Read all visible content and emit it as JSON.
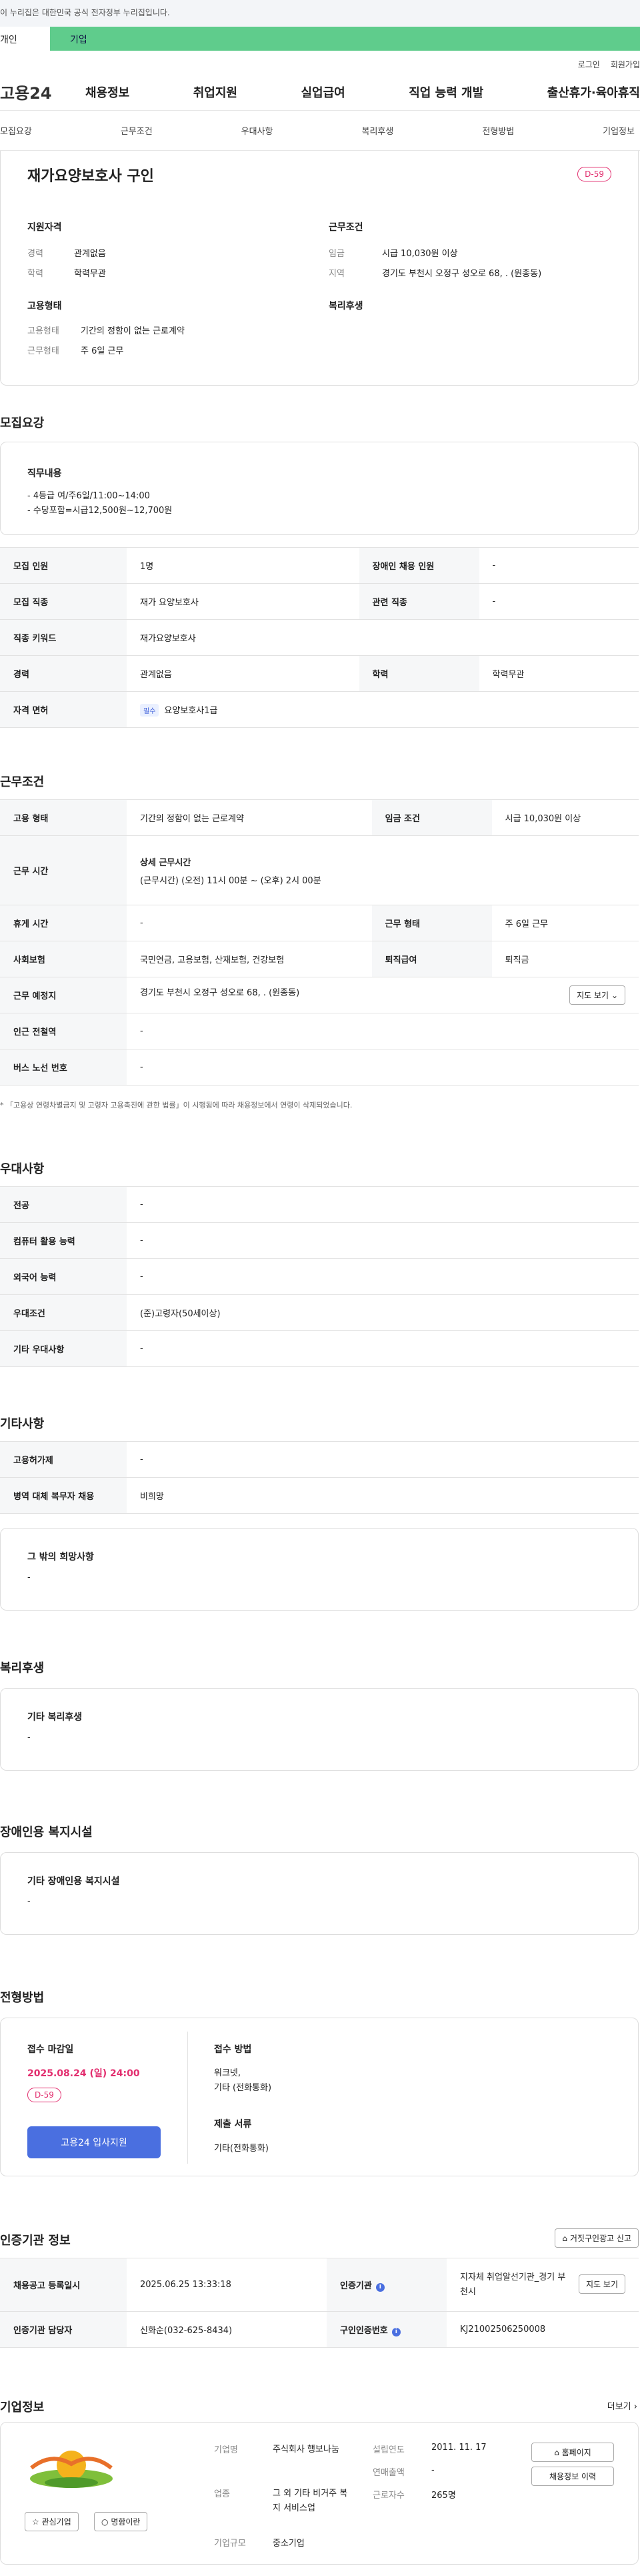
{
  "top_notice": "이 누리집은 대한민국 공식 전자정부 누리집입니다.",
  "user_tabs": [
    "개인",
    "기업"
  ],
  "util": [
    "로그인",
    "회원가입"
  ],
  "logo": "고용24",
  "gnb": [
    "채용정보",
    "취업지원",
    "실업급여",
    "직업 능력 개발",
    "출산휴가·육아휴직"
  ],
  "subnav": [
    "모집요강",
    "근무조건",
    "우대사항",
    "복리후생",
    "전형방법",
    "기업정보"
  ],
  "job": {
    "title": "재가요양보호사 구인",
    "dday": "D-59",
    "qual_head": "지원자격",
    "cond_head": "근무조건",
    "emp_head": "고용형태",
    "welfare_head": "복리후생",
    "qual": [
      [
        "경력",
        "관계없음"
      ],
      [
        "학력",
        "학력무관"
      ]
    ],
    "cond": [
      [
        "임금",
        "시급 10,030원 이상"
      ],
      [
        "지역",
        "경기도 부천시 오정구 성오로 68, . (원종동)"
      ]
    ],
    "emp": [
      [
        "고용형태",
        "기간의 정함이 없는 근로계약"
      ],
      [
        "근무형태",
        "주 6일 근무"
      ]
    ]
  },
  "recruit": {
    "head": "모집요강",
    "duty_head": "직무내용",
    "duty_lines": [
      "- 4등급 여/주6일/11:00~14:00",
      "- 수당포함=시급12,500원~12,700원"
    ],
    "rows": [
      [
        "모집 인원",
        "1명",
        "장애인 채용 인원",
        "-"
      ],
      [
        "모집 직종",
        "재가 요양보호사",
        "관련 직종",
        "-"
      ],
      [
        "직종 키워드",
        "재가요양보호사"
      ],
      [
        "경력",
        "관계없음",
        "학력",
        "학력무관"
      ]
    ],
    "license_label": "자격 면허",
    "license_tag": "필수",
    "license": "요양보호사1급"
  },
  "work": {
    "head": "근무조건",
    "emp_type_l": "고용 형태",
    "emp_type": "기간의 정함이 없는 근로계약",
    "wage_l": "임금 조건",
    "wage": "시급 10,030원 이상",
    "hours_l": "근무 시간",
    "hours_h": "상세 근무시간",
    "hours": "(근무시간) (오전) 11시 00분 ~ (오후) 2시 00분",
    "rest_l": "휴게 시간",
    "rest": "-",
    "shape_l": "근무 형태",
    "shape": "주 6일 근무",
    "ins_l": "사회보험",
    "ins": "국민연금, 고용보험, 산재보험, 건강보험",
    "sev_l": "퇴직급여",
    "sev": "퇴직금",
    "place_l": "근무 예정지",
    "place": "경기도 부천시 오정구 성오로 68, . (원종동)",
    "map_btn": "지도 보기",
    "subway_l": "인근 전철역",
    "subway": "-",
    "bus_l": "버스 노선 번호",
    "bus": "-",
    "note": "* 「고용상 연령차별금지 및 고령자 고용촉진에 관한 법률」이 시행됨에 따라 채용정보에서 연령이 삭제되었습니다."
  },
  "pref": {
    "head": "우대사항",
    "rows": [
      [
        "전공",
        "-"
      ],
      [
        "컴퓨터 활용 능력",
        "-"
      ],
      [
        "외국어 능력",
        "-"
      ],
      [
        "우대조건",
        "(준)고령자(50세이상)"
      ],
      [
        "기타 우대사항",
        "-"
      ]
    ]
  },
  "etc": {
    "head": "기타사항",
    "rows": [
      [
        "고용허가제",
        "-"
      ],
      [
        "병역 대체 복무자 채용",
        "비희망"
      ]
    ],
    "hope_head": "그 밖의 희망사항",
    "hope": "-"
  },
  "welfare": {
    "head": "복리후생",
    "sub": "기타 복리후생",
    "val": "-"
  },
  "disab": {
    "head": "장애인용 복지시설",
    "sub": "기타 장애인용 복지시설",
    "val": "-"
  },
  "select": {
    "head": "전형방법",
    "deadline_h": "접수 마감일",
    "deadline": "2025.08.24 (일) 24:00",
    "dday": "D-59",
    "apply": "고용24 입사지원",
    "method_h": "접수 방법",
    "methods": [
      "워크넷,",
      "기타 (전화통화)"
    ],
    "docs_h": "제출 서류",
    "docs": "기타(전화통화)"
  },
  "cert": {
    "head": "인증기관 정보",
    "report": "거짓구인광고 신고",
    "reg_l": "채용공고 등록일시",
    "reg": "2025.06.25 13:33:18",
    "org_l": "인증기관",
    "org": "지자체 취업알선기관_경기 부천시",
    "map": "지도 보기",
    "mgr_l": "인증기관 담당자",
    "mgr": "신화순(032-625-8434)",
    "num_l": "구인인증번호",
    "num": "KJ21002506250008"
  },
  "company": {
    "head": "기업정보",
    "more": "더보기",
    "fav": "관심기업",
    "card": "명함이란",
    "name_l": "기업명",
    "name": "주식회사 행보나눔",
    "ind_l": "업종",
    "ind": "그 외 기타 비거주 복지 서비스업",
    "size_l": "기업규모",
    "size": "중소기업",
    "est_l": "설립연도",
    "est": "2011. 11. 17",
    "sales_l": "연매출액",
    "sales": "-",
    "emp_l": "근로자수",
    "emp": "265명",
    "home": "홈페이지",
    "hist": "채용정보 이력"
  },
  "colors": {
    "accent": "#4a6fe0",
    "green": "#5fcc8c",
    "dday": "#e22d6e"
  }
}
